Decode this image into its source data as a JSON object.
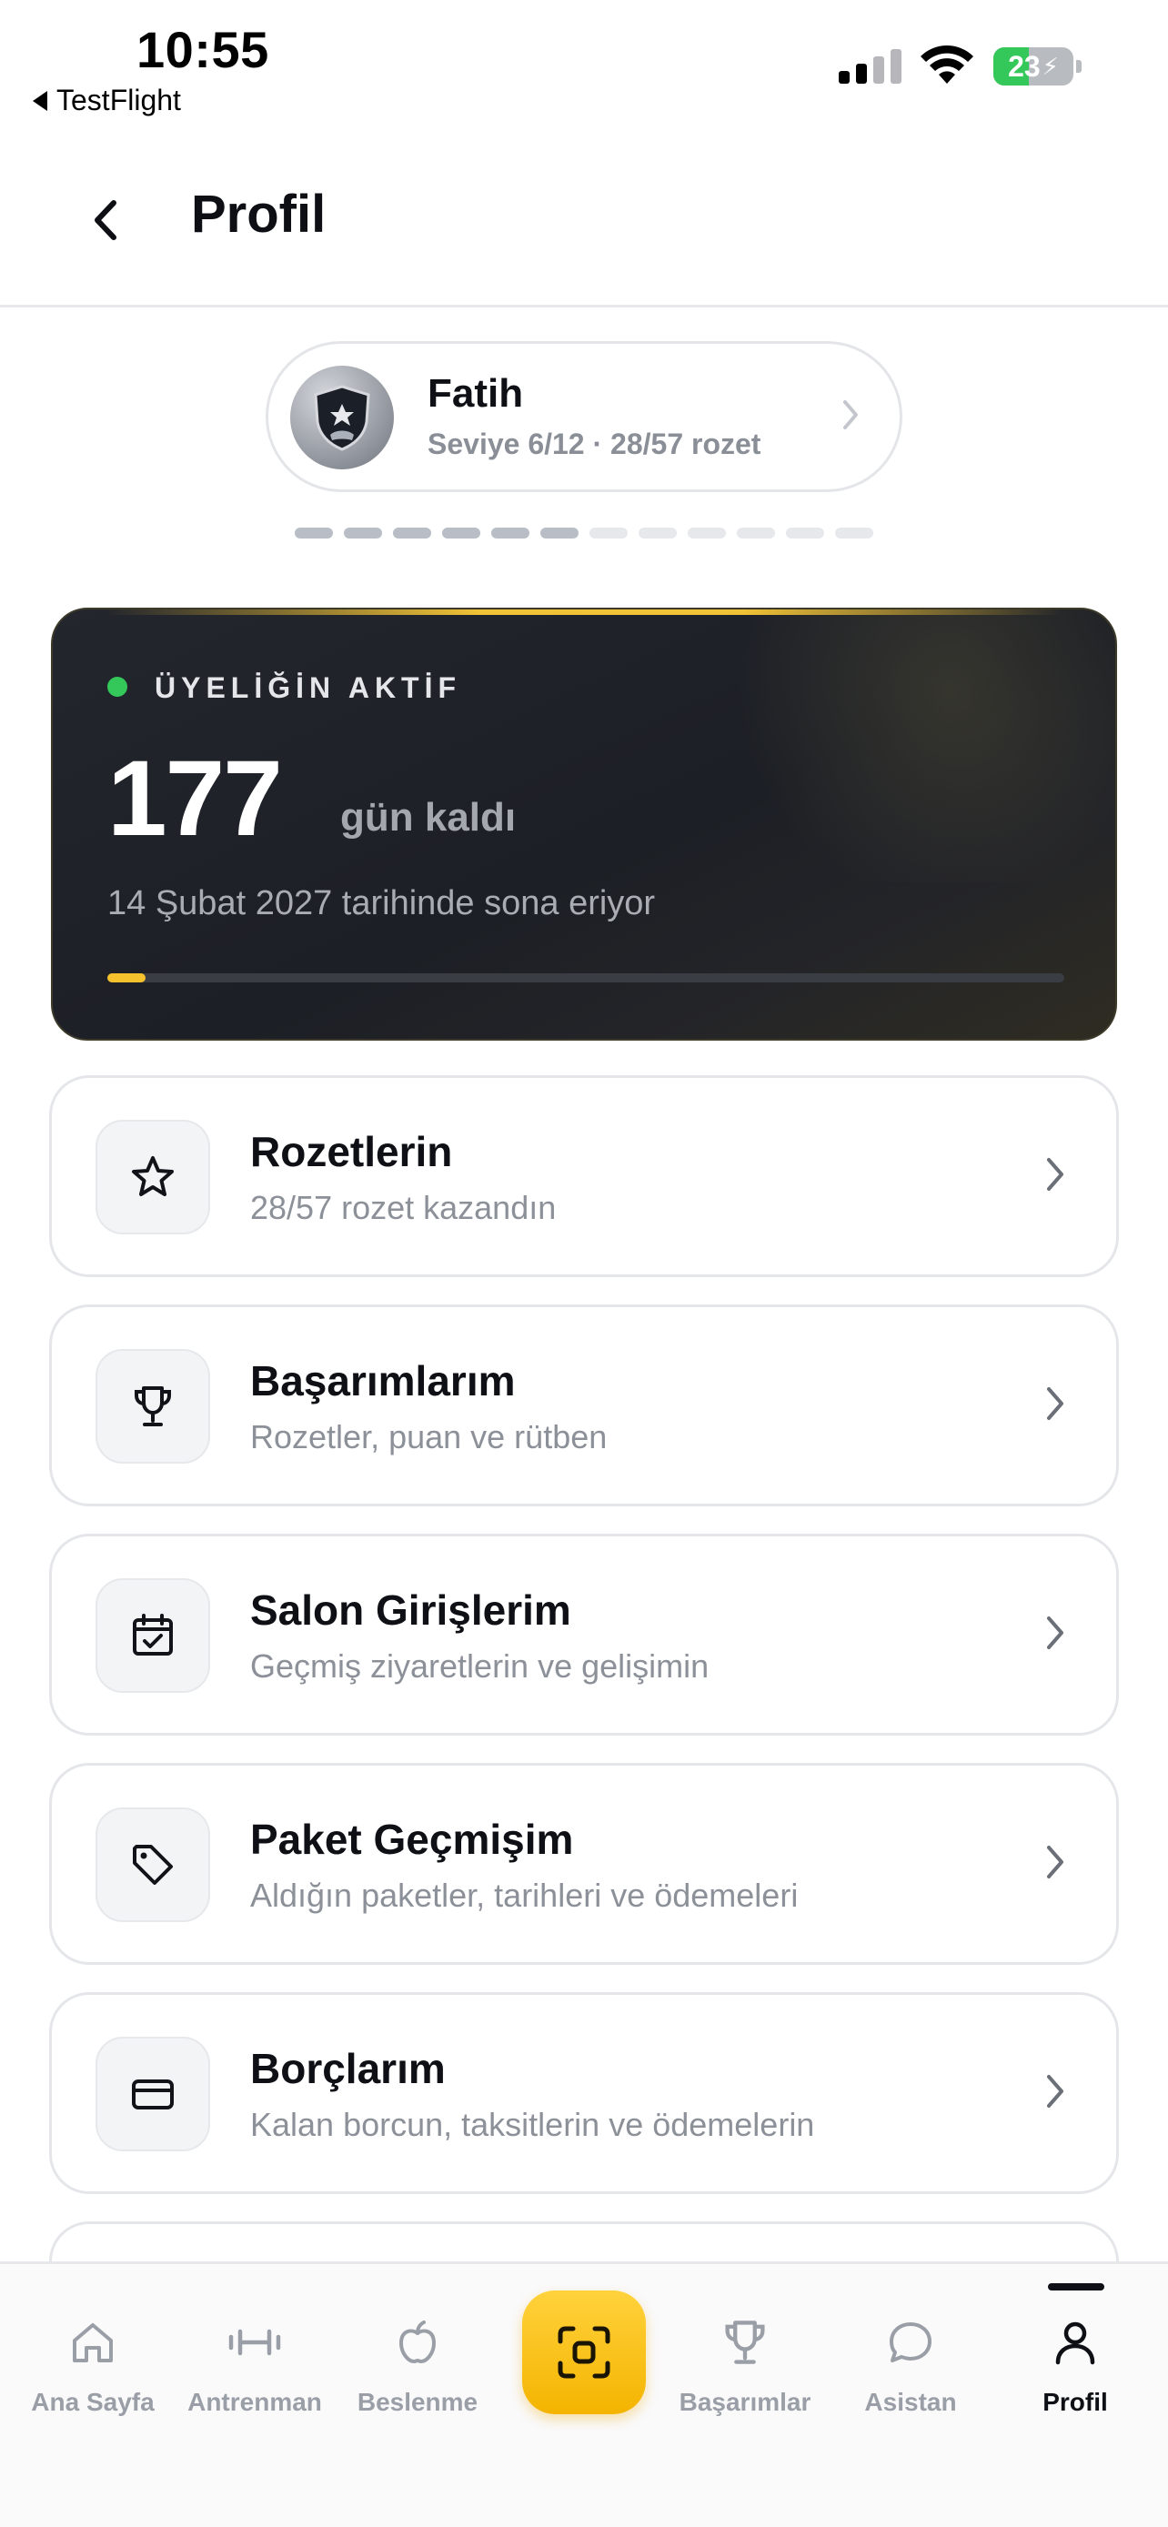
{
  "status_bar": {
    "time": "10:55",
    "back_app": "TestFlight",
    "battery": "23"
  },
  "header": {
    "title": "Profil"
  },
  "profile": {
    "name": "Fatih",
    "level_text": "Seviye 6/12 · 28/57 rozet",
    "level_current": 6,
    "level_total": 12
  },
  "membership": {
    "status_label": "ÜYELİĞİN AKTİF",
    "days_left": "177",
    "days_unit": "gün kaldı",
    "expiry_text": "14 Şubat 2027 tarihinde sona eriyor",
    "progress_fraction": 0.04,
    "accent_color": "#f5c12d",
    "status_color": "#34c759"
  },
  "menu": [
    {
      "title": "Rozetlerin",
      "subtitle": "28/57 rozet kazandın",
      "icon": "star-icon"
    },
    {
      "title": "Başarımlarım",
      "subtitle": "Rozetler, puan ve rütben",
      "icon": "trophy-icon"
    },
    {
      "title": "Salon Girişlerim",
      "subtitle": "Geçmiş ziyaretlerin ve gelişimin",
      "icon": "calendar-check-icon"
    },
    {
      "title": "Paket Geçmişim",
      "subtitle": "Aldığın paketler, tarihleri ve ödemeleri",
      "icon": "tag-icon"
    },
    {
      "title": "Borçlarım",
      "subtitle": "Kalan borcun, taksitlerin ve ödemelerin",
      "icon": "credit-card-icon"
    }
  ],
  "tabs": [
    {
      "label": "Ana Sayfa",
      "icon": "home-icon"
    },
    {
      "label": "Antrenman",
      "icon": "dumbbell-icon"
    },
    {
      "label": "Beslenme",
      "icon": "apple-icon"
    },
    {
      "label": "",
      "icon": "scan-icon"
    },
    {
      "label": "Başarımlar",
      "icon": "trophy-icon"
    },
    {
      "label": "Asistan",
      "icon": "chat-icon"
    },
    {
      "label": "Profil",
      "icon": "user-icon",
      "active": true
    }
  ]
}
